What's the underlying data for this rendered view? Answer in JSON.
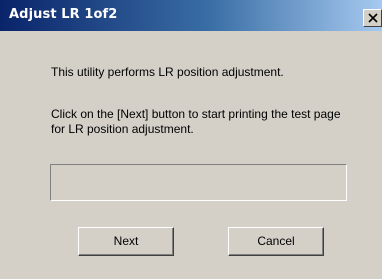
{
  "window": {
    "title": "Adjust LR 1of2"
  },
  "message": {
    "line1": "This utility performs LR position adjustment.",
    "line2": "Click on the [Next] button to start printing the test page for LR position adjustment."
  },
  "progress": {
    "value": 0
  },
  "buttons": {
    "next_label": "Next",
    "cancel_label": "Cancel"
  },
  "icons": {
    "close": "close-icon"
  },
  "colors": {
    "titlebar_start": "#0a246a",
    "titlebar_end": "#a6caf0",
    "dialog_bg": "#d4d0c8"
  }
}
